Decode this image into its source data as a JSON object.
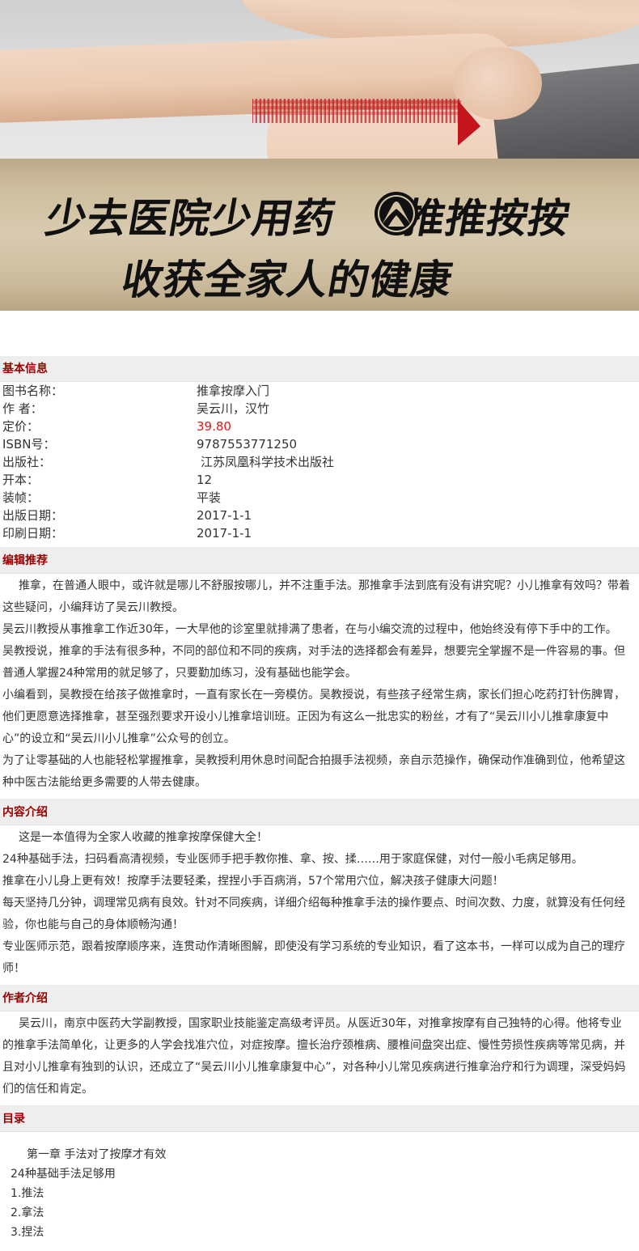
{
  "banner": {
    "slogan_line1_a": "少去医院少用药",
    "slogan_line1_b": "推推按按",
    "slogan_line2": "收获全家人的健康",
    "colors": {
      "gold": "#cdbd9d",
      "arrow": "#c4151c",
      "text": "#111111"
    },
    "logo_icon": "mountain-logo-icon"
  },
  "basic_info": {
    "title": "基本信息",
    "rows": [
      {
        "label": "图书名称：",
        "value": "推拿按摩入门"
      },
      {
        "label": "作 者：",
        "value": "吴云川，汉竹"
      },
      {
        "label": "定价：",
        "value": "39.80"
      },
      {
        "label": "ISBN号：",
        "value": "9787553771250"
      },
      {
        "label": "出版社：",
        "value": "江苏凤凰科学技术出版社"
      },
      {
        "label": "开本：",
        "value": "12"
      },
      {
        "label": "装帧：",
        "value": "平装"
      },
      {
        "label": "出版日期：",
        "value": "2017-1-1"
      },
      {
        "label": "印刷日期：",
        "value": "2017-1-1"
      }
    ]
  },
  "editor_rec": {
    "title": "编辑推荐",
    "paragraphs": [
      "推拿，在普通人眼中，或许就是哪儿不舒服按哪儿，并不注重手法。那推拿手法到底有没有讲究呢？小儿推拿有效吗？带着这些疑问，小编拜访了吴云川教授。",
      "吴云川教授从事推拿工作近30年，一大早他的诊室里就排满了患者，在与小编交流的过程中，他始终没有停下手中的工作。",
      "吴教授说，推拿的手法有很多种，不同的部位和不同的疾病，对手法的选择都会有差异，想要完全掌握不是一件容易的事。但普通人掌握24种常用的就足够了，只要勤加练习，没有基础也能学会。",
      "小编看到，吴教授在给孩子做推拿时，一直有家长在一旁模仿。吴教授说，有些孩子经常生病，家长们担心吃药打针伤脾胃，他们更愿意选择推拿，甚至强烈要求开设小儿推拿培训班。正因为有这么一批忠实的粉丝，才有了“吴云川小儿推拿康复中心”的设立和“吴云川小儿推拿”公众号的创立。",
      "为了让零基础的人也能轻松掌握推拿，吴教授利用休息时间配合拍摄手法视频，亲自示范操作，确保动作准确到位，他希望这种中医古法能给更多需要的人带去健康。"
    ]
  },
  "content_intro": {
    "title": "内容介绍",
    "paragraphs": [
      "这是一本值得为全家人收藏的推拿按摩保健大全！",
      "24种基础手法，扫码看高清视频，专业医师手把手教你推、拿、按、揉……用于家庭保健，对付一般小毛病足够用。",
      "推拿在小儿身上更有效！按摩手法要轻柔，捏捏小手百病消，57个常用穴位，解决孩子健康大问题！",
      "每天坚持几分钟，调理常见病有良效。针对不同疾病，详细介绍每种推拿手法的操作要点、时间次数、力度，就算没有任何经验，你也能与自己的身体顺畅沟通！",
      "专业医师示范，跟着按摩顺序来，连贯动作清晰图解，即使没有学习系统的专业知识，看了这本书，一样可以成为自己的理疗师！"
    ]
  },
  "author_intro": {
    "title": "作者介绍",
    "paragraphs": [
      "吴云川，南京中医药大学副教授，国家职业技能鉴定高级考评员。从医近30年，对推拿按摩有自己独特的心得。他将专业的推拿手法简单化，让更多的人学会找准穴位，对症按摩。擅长治疗颈椎病、腰椎间盘突出症、慢性劳损性疾病等常见病，并且对小儿推拿有独到的认识，还成立了“吴云川小儿推拿康复中心”，对各种小儿常见疾病进行推拿治疗和行为调理，深受妈妈们的信任和肯定。"
    ]
  },
  "toc": {
    "title": "目录",
    "chapter": "第一章 手法对了按摩才有效",
    "items": [
      "24种基础手法足够用",
      "1.推法",
      "2.拿法",
      "3.捏法"
    ]
  }
}
